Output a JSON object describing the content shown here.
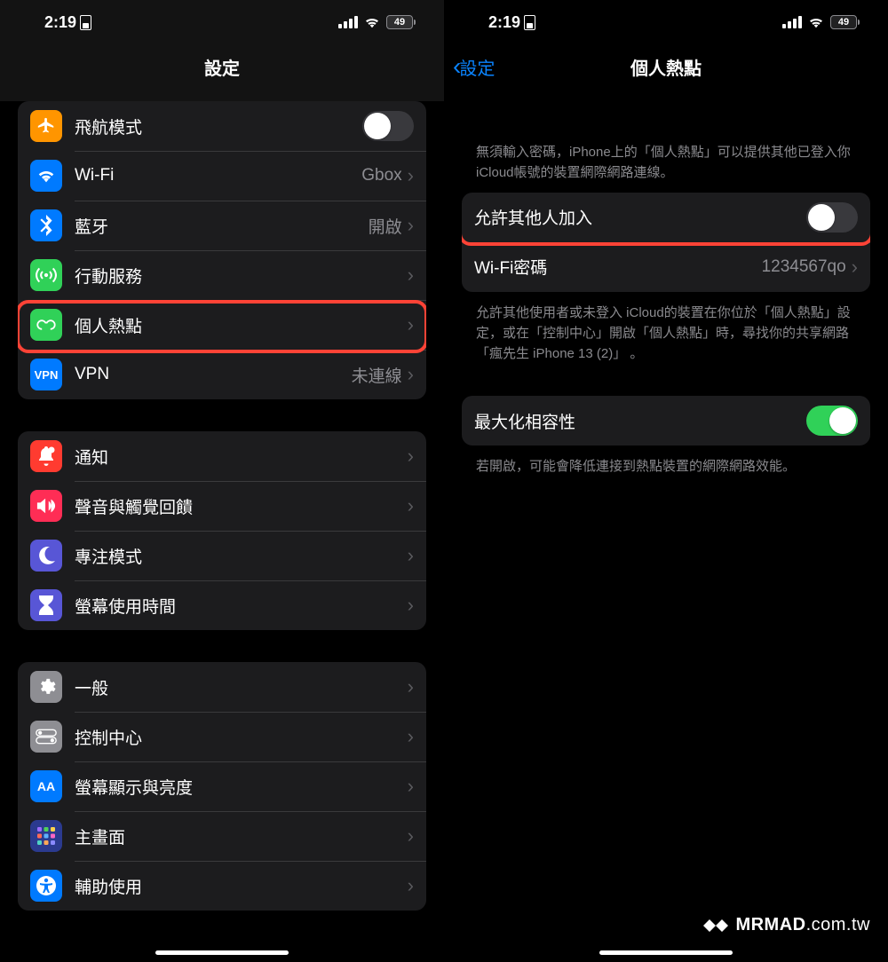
{
  "status": {
    "time": "2:19",
    "battery": "49"
  },
  "left": {
    "title": "設定",
    "group1": [
      {
        "name": "airplane",
        "label": "飛航模式",
        "value": "",
        "type": "toggle",
        "on": false,
        "icon_bg": "#ff9500"
      },
      {
        "name": "wifi",
        "label": "Wi-Fi",
        "value": "Gbox",
        "type": "link",
        "icon_bg": "#007aff"
      },
      {
        "name": "bluetooth",
        "label": "藍牙",
        "value": "開啟",
        "type": "link",
        "icon_bg": "#007aff"
      },
      {
        "name": "cellular",
        "label": "行動服務",
        "value": "",
        "type": "link",
        "icon_bg": "#30d158"
      },
      {
        "name": "hotspot",
        "label": "個人熱點",
        "value": "",
        "type": "link",
        "icon_bg": "#30d158",
        "highlight": true
      },
      {
        "name": "vpn",
        "label": "VPN",
        "value": "未連線",
        "type": "link",
        "icon_bg": "#007aff"
      }
    ],
    "group2": [
      {
        "name": "notifications",
        "label": "通知",
        "icon_bg": "#ff3b30"
      },
      {
        "name": "sounds",
        "label": "聲音與觸覺回饋",
        "icon_bg": "#ff2d55"
      },
      {
        "name": "focus",
        "label": "專注模式",
        "icon_bg": "#5856d6"
      },
      {
        "name": "screentime",
        "label": "螢幕使用時間",
        "icon_bg": "#5856d6"
      }
    ],
    "group3": [
      {
        "name": "general",
        "label": "一般",
        "icon_bg": "#8e8e93"
      },
      {
        "name": "control",
        "label": "控制中心",
        "icon_bg": "#8e8e93"
      },
      {
        "name": "display",
        "label": "螢幕顯示與亮度",
        "icon_bg": "#007aff"
      },
      {
        "name": "home",
        "label": "主畫面",
        "icon_bg": "#3355dd"
      },
      {
        "name": "accessibility",
        "label": "輔助使用",
        "icon_bg": "#007aff"
      }
    ]
  },
  "right": {
    "back": "設定",
    "title": "個人熱點",
    "intro": "無須輸入密碼，iPhone上的「個人熱點」可以提供其他已登入你 iCloud帳號的裝置網際網路連線。",
    "group1": [
      {
        "name": "allow-others",
        "label": "允許其他人加入",
        "type": "toggle",
        "on": false,
        "highlight": true
      },
      {
        "name": "wifi-password",
        "label": "Wi-Fi密碼",
        "value": "1234567qo",
        "type": "link"
      }
    ],
    "g1_footer": "允許其他使用者或未登入 iCloud的裝置在你位於「個人熱點」設定，或在「控制中心」開啟「個人熱點」時，尋找你的共享網路「瘋先生 iPhone 13 (2)」 。",
    "group2": [
      {
        "name": "maximize-compat",
        "label": "最大化相容性",
        "type": "toggle",
        "on": true
      }
    ],
    "g2_footer": "若開啟，可能會降低連接到熱點裝置的網際網路效能。"
  },
  "watermark": {
    "bold": "MRMAD",
    "rest": ".com.tw"
  }
}
